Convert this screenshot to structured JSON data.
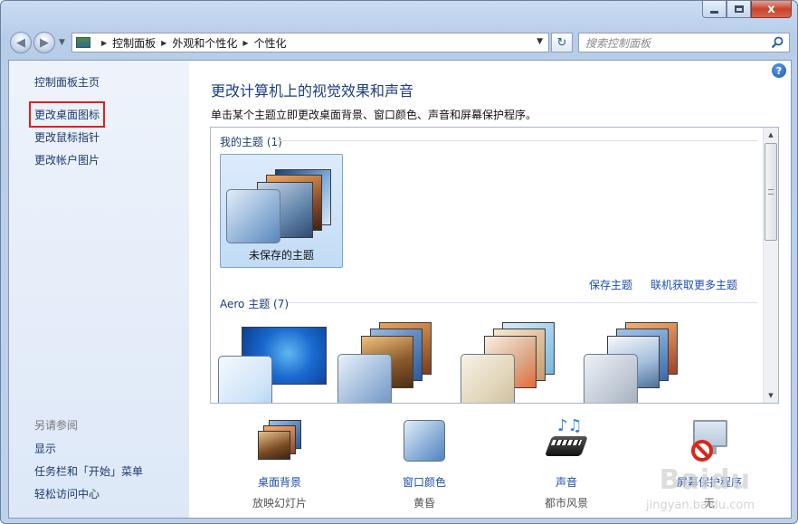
{
  "window": {
    "caption": {
      "minimize": "",
      "maximize": "",
      "close": "x"
    }
  },
  "address_bar": {
    "breadcrumbs": [
      "控制面板",
      "外观和个性化",
      "个性化"
    ],
    "search_placeholder": "搜索控制面板"
  },
  "sidebar": {
    "links": [
      "控制面板主页",
      "更改桌面图标",
      "更改鼠标指针",
      "更改帐户图片"
    ],
    "see_also_title": "另请参阅",
    "see_also": [
      "显示",
      "任务栏和「开始」菜单",
      "轻松访问中心"
    ]
  },
  "main": {
    "title": "更改计算机上的视觉效果和声音",
    "description": "单击某个主题立即更改桌面背景、窗口颜色、声音和屏幕保护程序。",
    "my_themes_header": "我的主题 (1)",
    "unsaved_theme_label": "未保存的主题",
    "save_theme_link": "保存主题",
    "get_more_link": "联机获取更多主题",
    "aero_header": "Aero 主题 (7)"
  },
  "bottom_bar": [
    {
      "label": "桌面背景",
      "sub": "放映幻灯片",
      "icon": "desktop-background-icon"
    },
    {
      "label": "窗口颜色",
      "sub": "黄昏",
      "icon": "window-color-icon"
    },
    {
      "label": "声音",
      "sub": "都市风景",
      "icon": "sound-icon"
    },
    {
      "label": "屏幕保护程序",
      "sub": "无",
      "icon": "screensaver-icon"
    }
  ],
  "watermark": {
    "text": "Baidu",
    "sub": "jingyan.baidu.com"
  },
  "colors": {
    "link": "#1d4ea8",
    "title": "#1b3e7d",
    "highlight_box": "#e0201c"
  }
}
